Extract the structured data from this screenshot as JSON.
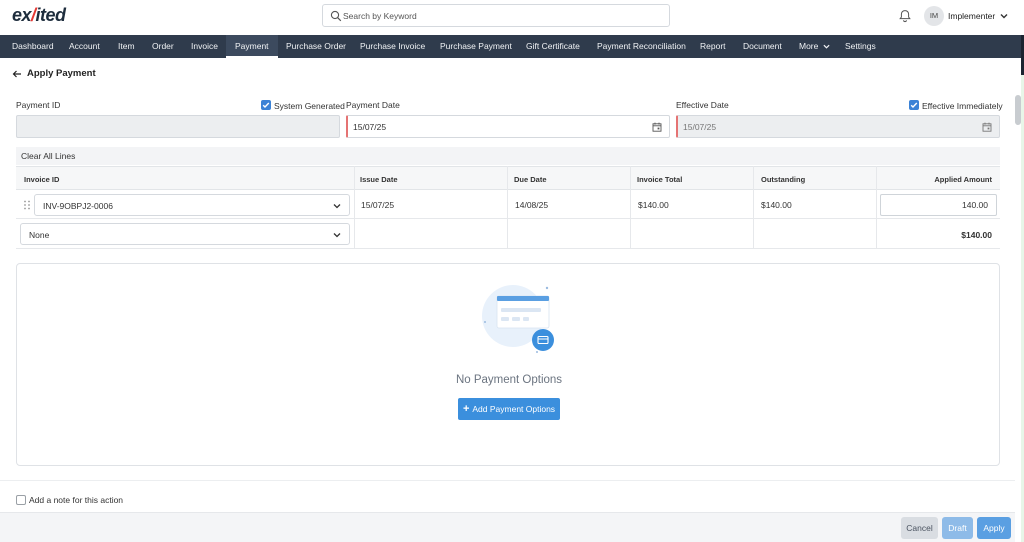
{
  "app": {
    "logo_main": "ex",
    "logo_slash": "/",
    "logo_end": "ited"
  },
  "search": {
    "placeholder": "Search by Keyword"
  },
  "user": {
    "initials": "IM",
    "name": "Implementer"
  },
  "nav": {
    "items": [
      "Dashboard",
      "Account",
      "Item",
      "Order",
      "Invoice",
      "Payment",
      "Purchase Order",
      "Purchase Invoice",
      "Purchase Payment",
      "Gift Certificate",
      "Payment Reconciliation",
      "Report",
      "Document",
      "More",
      "Settings"
    ],
    "active": "Payment"
  },
  "page": {
    "title": "Apply Payment"
  },
  "form": {
    "payment_id_label": "Payment ID",
    "payment_id_value": "",
    "system_generated_label": "System Generated",
    "system_generated_checked": true,
    "payment_date_label": "Payment Date",
    "payment_date_value": "15/07/25",
    "effective_date_label": "Effective Date",
    "effective_date_value": "15/07/25",
    "effective_immediately_label": "Effective Immediately",
    "effective_immediately_checked": true
  },
  "lines": {
    "clear_all_label": "Clear All Lines",
    "columns": [
      "Invoice ID",
      "Issue Date",
      "Due Date",
      "Invoice Total",
      "Outstanding",
      "Applied Amount"
    ],
    "rows": [
      {
        "invoice_id": "INV-9OBPJ2-0006",
        "issue_date": "15/07/25",
        "due_date": "14/08/25",
        "invoice_total": "$140.00",
        "outstanding": "$140.00",
        "applied_amount": "140.00"
      }
    ],
    "new_line_select": "None",
    "total_applied": "$140.00"
  },
  "payment_options": {
    "empty_text": "No Payment Options",
    "add_button_label": "Add Payment Options"
  },
  "note": {
    "label": "Add a note for this action",
    "checked": false
  },
  "footer": {
    "cancel_label": "Cancel",
    "draft_label": "Draft",
    "apply_label": "Apply"
  },
  "colors": {
    "nav_bg": "#2f3b4c",
    "accent": "#3b8fdd",
    "required": "#e57373"
  }
}
